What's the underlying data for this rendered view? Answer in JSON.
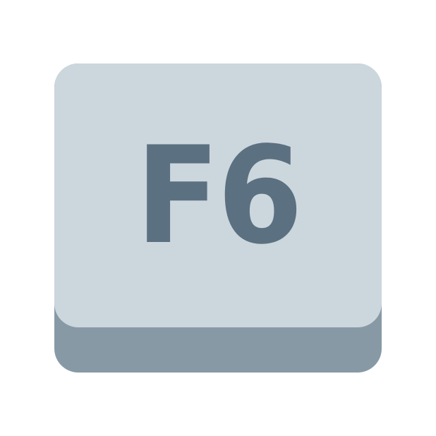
{
  "key": {
    "label": "F6",
    "colors": {
      "face": "#ccd6dd",
      "side": "#8899a6",
      "label": "#5b7080",
      "background": "#ffffff"
    }
  }
}
